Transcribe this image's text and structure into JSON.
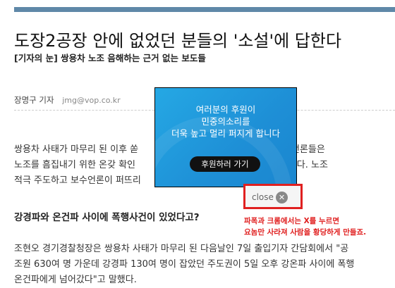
{
  "article": {
    "headline": "도장2공장 안에 없었던 분들의 '소설'에 답한다",
    "subheadline": "[기자의 눈] 쌍용차 노조 음해하는 근거 없는 보도들",
    "author": "장명구 기자",
    "email": "jmg@vop.co.kr",
    "para1_lines": [
      "쌍용차 사태가 마무리 된 이후 쏟                                    관이다. 보수언론들은 ",
      "노조를 흠집내기 위한 온갖 확인                                    도를 일삼고 있다. 노조",
      "적극 주도하고 보수언론이 퍼뜨리"
    ],
    "section_heading": "강경파와 온건파 사이에 폭행사건이 있었다고?",
    "para2_lines": [
      "조현오 경기경찰청장은 쌍용차 사태가 마무리 된 다음날인 7일 출입기자 간담회에서 \"공",
      "조원 630여 명 가운데 강경파 130여 명이 잡았던 주도권이 5일 오후 강온파 사이에 폭행",
      "온건파에게 넘어갔다\"고 말했다."
    ]
  },
  "ad_popup": {
    "lines": [
      "여러분의 후원이",
      "민중의소리를",
      "더욱 높고 멀리 퍼지게 합니다"
    ],
    "button_label": "후원하러 가기",
    "close_label": "close"
  },
  "annotation": {
    "line1": "파폭과 크롬에서는 X를 누르면",
    "line2": "요놈만 사라져 사람을 황당하게 만들죠."
  },
  "colors": {
    "accent_bar": "#5f88a8",
    "ad_blue": "#1e8fd6",
    "annotation_red": "#e02020"
  }
}
